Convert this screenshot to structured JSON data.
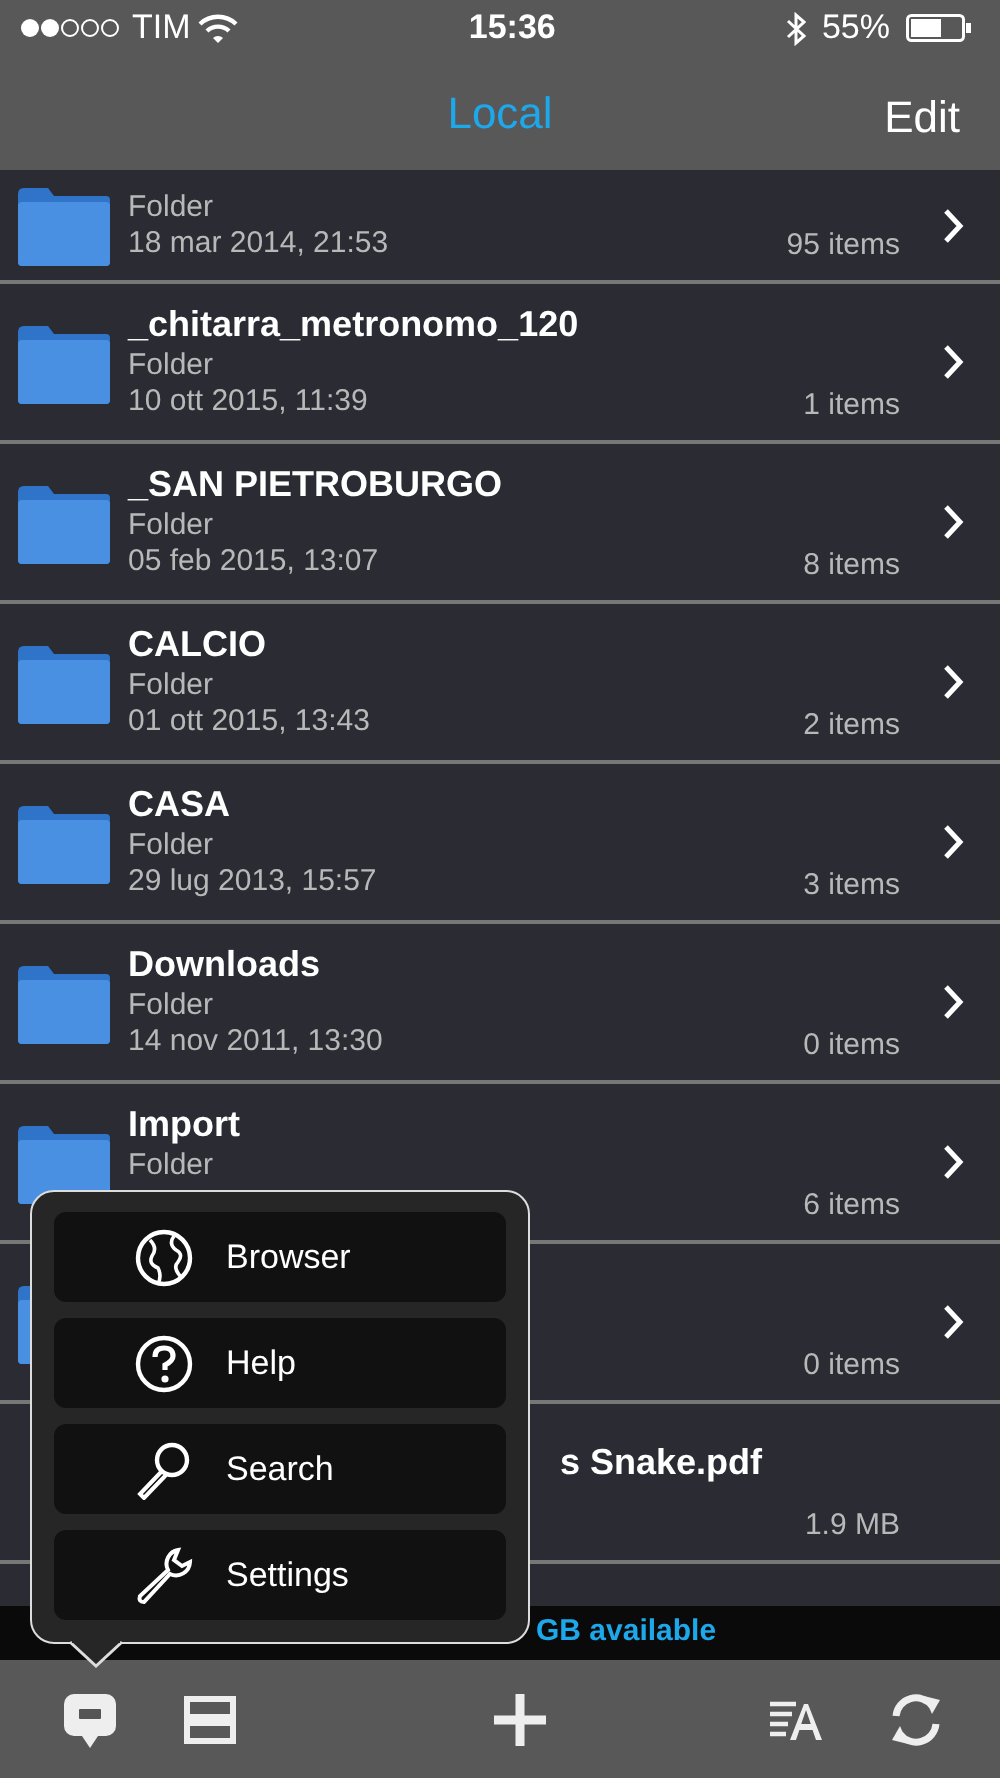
{
  "status_bar": {
    "carrier": "TIM",
    "time": "15:36",
    "battery": "55%"
  },
  "nav_bar": {
    "title": "Local",
    "action": "Edit"
  },
  "rows": [
    {
      "kind": "folder",
      "subtitle": "Folder",
      "date": "18 mar 2014, 21:53",
      "count": "95 items"
    },
    {
      "kind": "folder",
      "name": "_chitarra_metronomo_120",
      "subtitle": "Folder",
      "date": "10 ott 2015, 11:39",
      "count": "1 items"
    },
    {
      "kind": "folder",
      "name": "_SAN PIETROBURGO",
      "subtitle": "Folder",
      "date": "05 feb 2015, 13:07",
      "count": "8 items"
    },
    {
      "kind": "folder",
      "name": "CALCIO",
      "subtitle": "Folder",
      "date": "01 ott 2015, 13:43",
      "count": "2 items"
    },
    {
      "kind": "folder",
      "name": "CASA",
      "subtitle": "Folder",
      "date": "29 lug 2013, 15:57",
      "count": "3 items"
    },
    {
      "kind": "folder",
      "name": "Downloads",
      "subtitle": "Folder",
      "date": "14 nov 2011, 13:30",
      "count": "0 items"
    },
    {
      "kind": "folder",
      "name": "Import",
      "subtitle": "Folder",
      "count": "6 items"
    },
    {
      "kind": "folder",
      "count": "0 items"
    },
    {
      "kind": "file",
      "name": "s Snake.pdf",
      "count": "1.9 MB"
    }
  ],
  "storage_info": "GB available",
  "popover_menu": [
    {
      "kind": "globe",
      "label": "Browser"
    },
    {
      "kind": "help",
      "label": "Help"
    },
    {
      "kind": "search",
      "label": "Search"
    },
    {
      "kind": "wrench",
      "label": "Settings"
    }
  ],
  "toolbar": [
    {
      "kind": "bubble"
    },
    {
      "kind": "rows"
    },
    {
      "kind": "plus"
    },
    {
      "kind": "sort"
    },
    {
      "kind": "refresh"
    }
  ]
}
